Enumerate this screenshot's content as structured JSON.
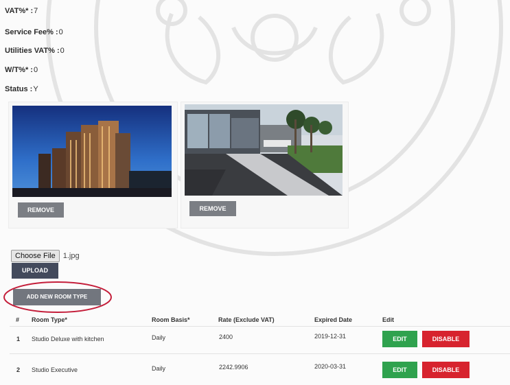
{
  "details": {
    "vat_label": "VAT%* :",
    "vat_value": "7",
    "service_label": "Service Fee% :",
    "service_value": "0",
    "utilities_label": "Utilities VAT% :",
    "utilities_value": "0",
    "wt_label": "W/T%* :",
    "wt_value": "0",
    "status_label": "Status :",
    "status_value": "Y"
  },
  "images": [
    {
      "remove_label": "REMOVE"
    },
    {
      "remove_label": "REMOVE"
    }
  ],
  "upload": {
    "choose_file_label": "Choose File",
    "file_name": "1.jpg",
    "upload_label": "UPLOAD"
  },
  "add_room_type_label": "ADD NEW ROOM TYPE",
  "table": {
    "headers": [
      "#",
      "Room Type*",
      "Room Basis*",
      "Rate (Exclude VAT)",
      "Expired Date",
      "Edit"
    ],
    "rows": [
      {
        "num": "1",
        "room_type": "Studio Deluxe with kitchen",
        "basis": "Daily",
        "rate": "2400",
        "expired": "2019-12-31",
        "edit_label": "EDIT",
        "disable_label": "DISABLE"
      },
      {
        "num": "2",
        "room_type": "Studio Executive",
        "basis": "Daily",
        "rate": "2242.9906",
        "expired": "2020-03-31",
        "edit_label": "EDIT",
        "disable_label": "DISABLE"
      }
    ]
  },
  "colors": {
    "edit": "#2fa24e",
    "disable": "#d7232e",
    "upload": "#434a5c",
    "highlight_circle": "#c41e3a"
  }
}
